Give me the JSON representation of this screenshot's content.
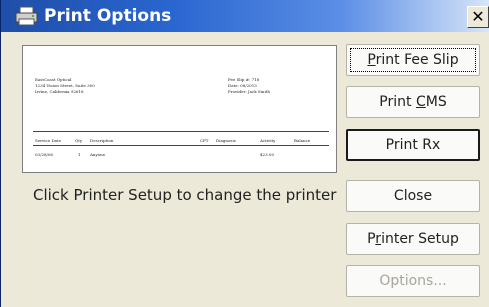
{
  "window": {
    "title": "Print Options",
    "close_glyph": "✕",
    "icon": "printer-icon"
  },
  "preview": {
    "practice_lines": [
      "EastCoast Optical",
      "1234 Vision Street, Suite 300",
      "Irvine, California 92618"
    ],
    "meta_lines": [
      "Fee Slip #:  718",
      "Date:  08/2013",
      "Provider:  Jack Smith"
    ],
    "columns": [
      "Service Date",
      "Qty",
      "Description",
      "CPT",
      "Diagnosis",
      "Activity",
      "Balance"
    ],
    "rows": [
      [
        "03/28/06",
        "1",
        "Anyone",
        "",
        "",
        "$23.00",
        ""
      ]
    ]
  },
  "hint_text": "Click Printer Setup to change the printer",
  "buttons": {
    "print_fee_slip": {
      "pre": "",
      "accel": "P",
      "post": "rint Fee Slip"
    },
    "print_cms": {
      "pre": "Print ",
      "accel": "C",
      "post": "MS"
    },
    "print_rx": {
      "label": "Print Rx"
    },
    "close": {
      "label": "Close"
    },
    "printer_setup": {
      "pre": "P",
      "accel": "r",
      "post": "inter Setup"
    },
    "options": {
      "label": "Options..."
    }
  },
  "colors": {
    "title_gradient_start": "#1e4ea8",
    "dialog_bg": "#ece9d8",
    "disabled_text": "#a7a49c"
  }
}
